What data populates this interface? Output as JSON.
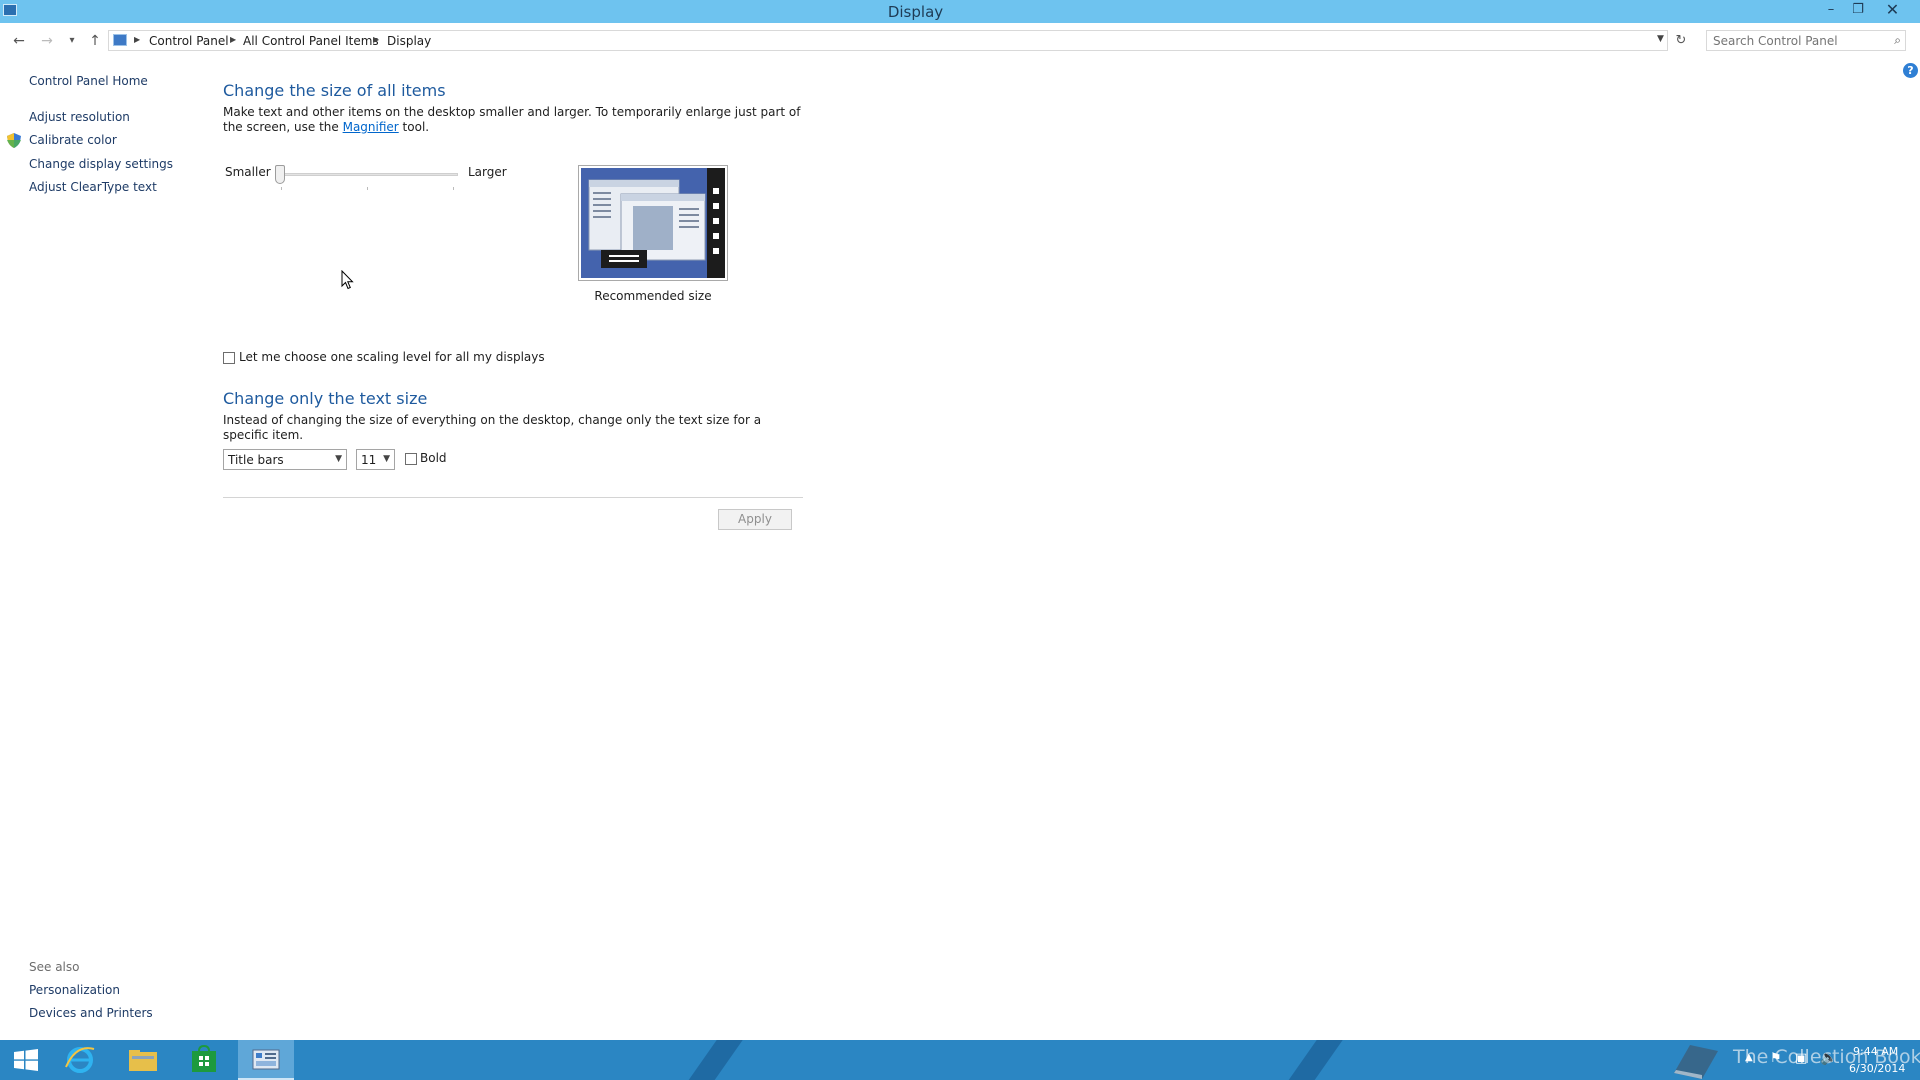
{
  "window": {
    "title": "Display",
    "minimize_glyph": "–",
    "maximize_glyph": "❐",
    "close_glyph": "✕"
  },
  "navigation": {
    "back_glyph": "←",
    "forward_glyph": "→",
    "recent_glyph": "▾",
    "up_glyph": "↑",
    "breadcrumbs": [
      "Control Panel",
      "All Control Panel Items",
      "Display"
    ],
    "refresh_glyph": "↻",
    "search_placeholder": "Search Control Panel"
  },
  "sidebar": {
    "home": "Control Panel Home",
    "links": [
      "Adjust resolution",
      "Calibrate color",
      "Change display settings",
      "Adjust ClearType text"
    ],
    "see_also_label": "See also",
    "see_also_links": [
      "Personalization",
      "Devices and Printers"
    ]
  },
  "main": {
    "section1": {
      "heading": "Change the size of all items",
      "description_before": "Make text and other items on the desktop smaller and larger. To temporarily enlarge just part of the screen, use the ",
      "magnifier_link": "Magnifier",
      "description_after": " tool.",
      "slider": {
        "min_label": "Smaller",
        "max_label": "Larger",
        "position": 0
      },
      "preview_caption": "Recommended size"
    },
    "scaling_checkbox_label": "Let me choose one scaling level for all my displays",
    "section2": {
      "heading": "Change only the text size",
      "description": "Instead of changing the size of everything on the desktop, change only the text size for a specific item.",
      "item_select": "Title bars",
      "size_select": "11",
      "bold_label": "Bold"
    },
    "apply_label": "Apply",
    "help_glyph": "?"
  },
  "taskbar": {
    "watermark": "The Collection Book",
    "time": "9:44 AM",
    "date": "6/30/2014"
  },
  "colors": {
    "titlebar": "#6ec3ef",
    "taskbar": "#2b86c3",
    "heading": "#1e5a9e",
    "link": "#0066cc"
  }
}
